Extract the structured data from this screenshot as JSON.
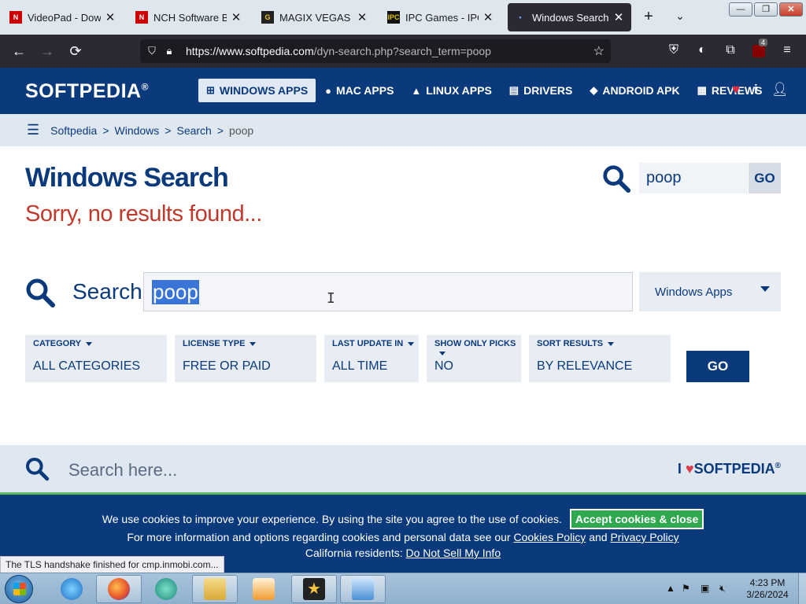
{
  "browser": {
    "tabs": [
      {
        "title": "VideoPad - Downlo",
        "favicon": "nch-icon"
      },
      {
        "title": "NCH Software Bug",
        "favicon": "nch-icon"
      },
      {
        "title": "MAGIX VEGAS Pro",
        "favicon": "magix-icon"
      },
      {
        "title": "IPC Games - IPC Ga",
        "favicon": "ipc-icon"
      },
      {
        "title": "Windows Search: p",
        "favicon": "softpedia-icon",
        "active": true
      }
    ],
    "url_domain": "https://www.softpedia.com",
    "url_path": "/dyn-search.php?search_term=poop",
    "extension_badge": "4"
  },
  "site": {
    "logo": "SOFTPEDIA",
    "logo_mark": "®",
    "nav": [
      {
        "label": "WINDOWS APPS",
        "icon": "windows-icon",
        "active": true
      },
      {
        "label": "MAC APPS",
        "icon": "apple-icon"
      },
      {
        "label": "LINUX APPS",
        "icon": "linux-icon"
      },
      {
        "label": "DRIVERS",
        "icon": "drivers-icon"
      },
      {
        "label": "ANDROID APK",
        "icon": "android-icon"
      },
      {
        "label": "REVIEWS",
        "icon": "reviews-icon"
      }
    ]
  },
  "breadcrumb": [
    "Softpedia",
    "Windows",
    "Search",
    "poop"
  ],
  "main": {
    "title": "Windows Search",
    "no_results": "Sorry, no results found...",
    "top_search_value": "poop",
    "top_go": "GO",
    "search_label": "Search:",
    "search_value": "poop",
    "platform": "Windows Apps",
    "filters": [
      {
        "label": "CATEGORY",
        "value": "ALL CATEGORIES"
      },
      {
        "label": "LICENSE TYPE",
        "value": "FREE OR PAID"
      },
      {
        "label": "LAST UPDATE IN",
        "value": "ALL TIME"
      },
      {
        "label": "SHOW ONLY PICKS",
        "value": "NO"
      },
      {
        "label": "SORT RESULTS",
        "value": "BY RELEVANCE"
      }
    ],
    "go": "GO"
  },
  "footer": {
    "search_placeholder": "Search here...",
    "love_prefix": "I",
    "love_brand": "SOFTPEDIA",
    "love_mark": "®"
  },
  "cookie": {
    "line1": "We use cookies to improve your experience. By using the site you agree to the use of cookies.",
    "accept": "Accept cookies & close",
    "line2_prefix": "For more information and options regarding cookies and personal data see our",
    "cookies_policy": "Cookies Policy",
    "and": "and",
    "privacy_policy": "Privacy Policy",
    "line3_prefix": "California residents:",
    "do_not_sell": "Do Not Sell My Info"
  },
  "status_text": "The TLS handshake finished for cmp.inmobi.com...",
  "taskbar": {
    "time": "4:23 PM",
    "date": "3/26/2024"
  },
  "colors": {
    "brand": "#0b3a7c",
    "error": "#c0392b",
    "accept": "#2fa84f"
  }
}
